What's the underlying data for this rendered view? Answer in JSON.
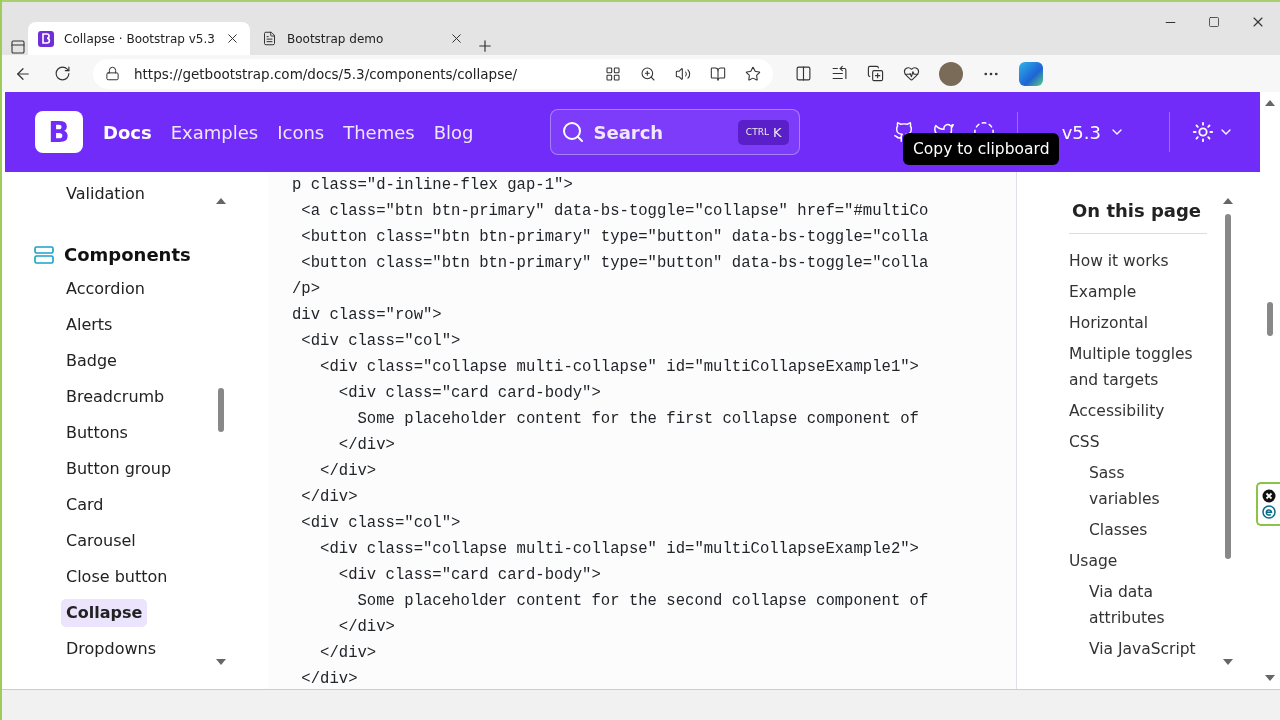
{
  "browser": {
    "tabs": [
      {
        "title": "Collapse · Bootstrap v5.3",
        "kind": "brand",
        "selected": true
      },
      {
        "title": "Bootstrap demo",
        "kind": "page",
        "selected": false
      }
    ],
    "url": "https://getbootstrap.com/docs/5.3/components/collapse/"
  },
  "navbar": {
    "logo": "B",
    "links": [
      {
        "label": "Docs",
        "selected": true
      },
      {
        "label": "Examples",
        "selected": false
      },
      {
        "label": "Icons",
        "selected": false
      },
      {
        "label": "Themes",
        "selected": false
      },
      {
        "label": "Blog",
        "selected": false
      }
    ],
    "search": {
      "placeholder": "Search",
      "shortcut_mod": "CTRL",
      "shortcut_key": "K"
    },
    "version": "v5.3",
    "tooltip": "Copy to clipboard"
  },
  "sidebar": {
    "above": "Validation",
    "section": {
      "title": "Components",
      "items": [
        {
          "label": "Accordion",
          "selected": false
        },
        {
          "label": "Alerts",
          "selected": false
        },
        {
          "label": "Badge",
          "selected": false
        },
        {
          "label": "Breadcrumb",
          "selected": false
        },
        {
          "label": "Buttons",
          "selected": false
        },
        {
          "label": "Button group",
          "selected": false
        },
        {
          "label": "Card",
          "selected": false
        },
        {
          "label": "Carousel",
          "selected": false
        },
        {
          "label": "Close button",
          "selected": false
        },
        {
          "label": "Collapse",
          "selected": true
        },
        {
          "label": "Dropdowns",
          "selected": false
        }
      ]
    }
  },
  "code": {
    "lines": [
      "p class=\"d-inline-flex gap-1\">",
      " <a class=\"btn btn-primary\" data-bs-toggle=\"collapse\" href=\"#multiCo",
      " <button class=\"btn btn-primary\" type=\"button\" data-bs-toggle=\"colla",
      " <button class=\"btn btn-primary\" type=\"button\" data-bs-toggle=\"colla",
      "/p>",
      "div class=\"row\">",
      " <div class=\"col\">",
      "   <div class=\"collapse multi-collapse\" id=\"multiCollapseExample1\">",
      "     <div class=\"card card-body\">",
      "       Some placeholder content for the first collapse component of",
      "     </div>",
      "   </div>",
      " </div>",
      " <div class=\"col\">",
      "   <div class=\"collapse multi-collapse\" id=\"multiCollapseExample2\">",
      "     <div class=\"card card-body\">",
      "       Some placeholder content for the second collapse component of",
      "     </div>",
      "   </div>",
      " </div>"
    ]
  },
  "toc": {
    "title": "On this page",
    "items": [
      {
        "label": "How it works"
      },
      {
        "label": "Example"
      },
      {
        "label": "Horizontal"
      },
      {
        "label": "Multiple toggles and targets"
      },
      {
        "label": "Accessibility"
      },
      {
        "label": "CSS",
        "children": [
          {
            "label": "Sass variables"
          },
          {
            "label": "Classes"
          }
        ]
      },
      {
        "label": "Usage",
        "children": [
          {
            "label": "Via data attributes"
          },
          {
            "label": "Via JavaScript"
          }
        ]
      }
    ]
  }
}
